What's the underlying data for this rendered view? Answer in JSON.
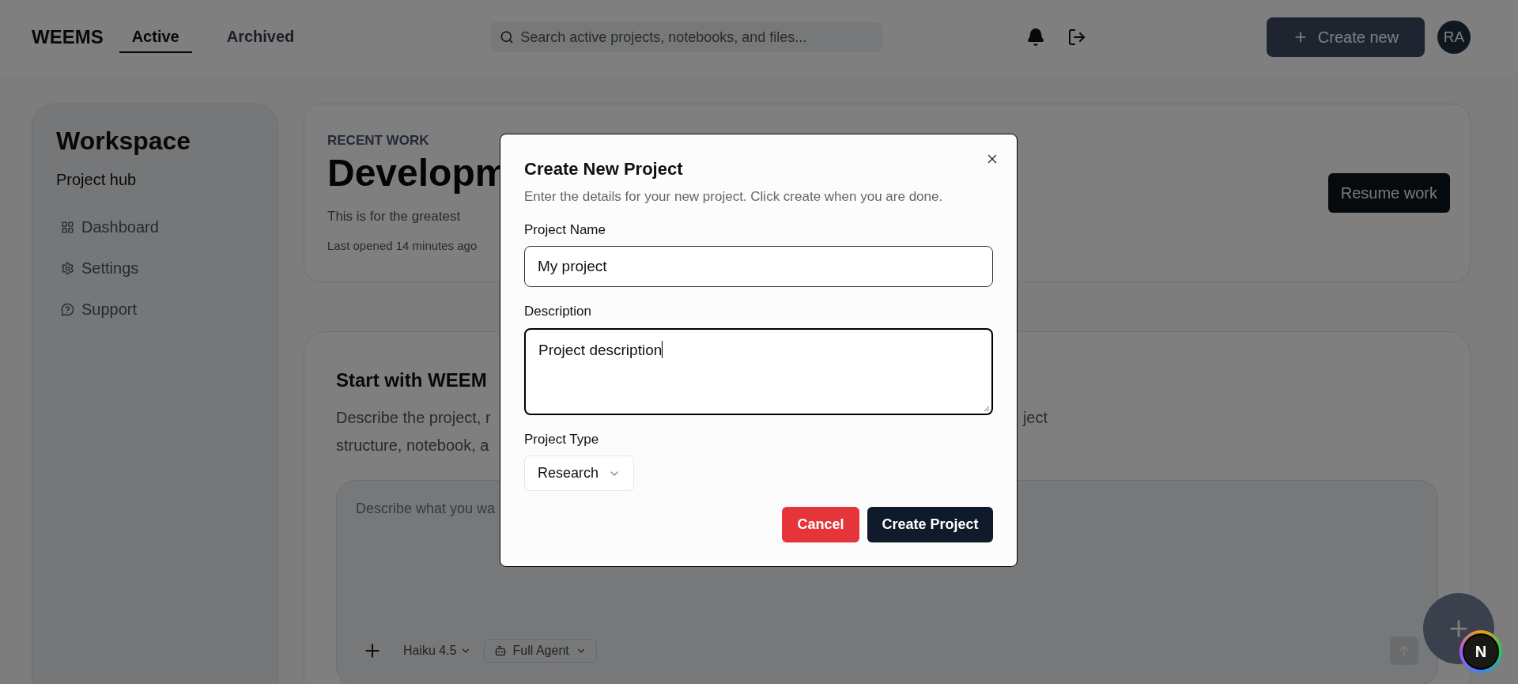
{
  "header": {
    "logo": "WEEMS",
    "tabs": [
      {
        "label": "Active",
        "selected": true
      },
      {
        "label": "Archived",
        "selected": false
      }
    ],
    "search": {
      "placeholder": "Search active projects, notebooks, and files..."
    },
    "create_button": "Create new",
    "avatar": "RA"
  },
  "sidebar": {
    "title": "Workspace",
    "subtitle": "Project hub",
    "items": [
      {
        "label": "Dashboard"
      },
      {
        "label": "Settings"
      },
      {
        "label": "Support"
      }
    ]
  },
  "recent_work": {
    "eyebrow": "RECENT WORK",
    "title": "Developm",
    "description": "This is for the greatest",
    "last_opened": "Last opened 14 minutes ago",
    "button": "Resume work"
  },
  "start": {
    "title": "Start with WEEM",
    "description_lines": [
      {
        "left": "Describe the project, r",
        "right": "ject"
      },
      {
        "left": "structure, notebook, a"
      }
    ],
    "composer": {
      "placeholder": "Describe what you wa",
      "model": "Haiku 4.5",
      "mode": "Full Agent"
    }
  },
  "dialog": {
    "title": "Create New Project",
    "subtitle": "Enter the details for your new project. Click create when you are done.",
    "fields": [
      {
        "kind": "input",
        "label": "Project Name",
        "value": "My project",
        "focused": false
      },
      {
        "kind": "textarea",
        "label": "Description",
        "value": "Project description",
        "focused": true
      },
      {
        "kind": "select",
        "label": "Project Type",
        "value": "Research"
      }
    ],
    "buttons": [
      {
        "kind": "cancel",
        "label": "Cancel"
      },
      {
        "kind": "primary",
        "label": "Create Project"
      }
    ]
  },
  "dev_badge": "N"
}
